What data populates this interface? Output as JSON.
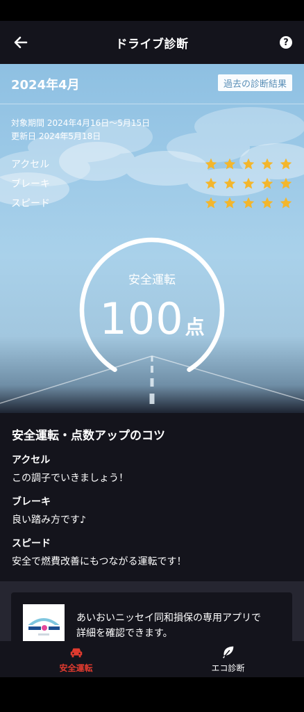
{
  "header": {
    "title": "ドライブ診断",
    "help_glyph": "?"
  },
  "summary": {
    "month": "2024年4月",
    "history_button": "過去の診断結果",
    "period": "対象期間 2024年4月16日～5月15日",
    "updated": "更新日 2024年5月18日"
  },
  "ratings": [
    {
      "label": "アクセル",
      "stars": 5
    },
    {
      "label": "ブレーキ",
      "stars": 5
    },
    {
      "label": "スピード",
      "stars": 5
    }
  ],
  "score": {
    "label": "安全運転",
    "value": "100",
    "unit": "点"
  },
  "tips": {
    "title": "安全運転・点数アップのコツ",
    "items": [
      {
        "label": "アクセル",
        "text": "この調子でいきましょう！"
      },
      {
        "label": "ブレーキ",
        "text": "良い踏み方です♪"
      },
      {
        "label": "スピード",
        "text": "安全で燃費改善にもつながる運転です！"
      }
    ]
  },
  "app_banner": {
    "line1": "あいおいニッセイ同和損保の専用アプリで",
    "line2": "詳細を確認できます。"
  },
  "bottom_nav": {
    "items": [
      {
        "label": "安全運転",
        "icon": "car-icon",
        "active": true
      },
      {
        "label": "エコ診断",
        "icon": "leaf-icon",
        "active": false
      }
    ]
  },
  "colors": {
    "accent": "#e23b2f",
    "star": "#f3b62c",
    "background": "#14141c",
    "sky": "#9fcbe8"
  }
}
